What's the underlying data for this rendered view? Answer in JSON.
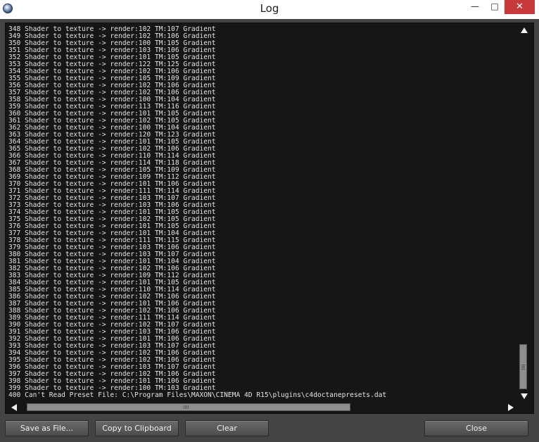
{
  "window": {
    "title": "Log",
    "minimize_glyph": "—",
    "maximize_glyph": "□",
    "close_glyph": "✕"
  },
  "log": {
    "lines": [
      {
        "num": "348",
        "text": "Shader to texture -> render:102 TM:107 Gradient"
      },
      {
        "num": "349",
        "text": "Shader to texture -> render:102 TM:106 Gradient"
      },
      {
        "num": "350",
        "text": "Shader to texture -> render:100 TM:105 Gradient"
      },
      {
        "num": "351",
        "text": "Shader to texture -> render:103 TM:106 Gradient"
      },
      {
        "num": "352",
        "text": "Shader to texture -> render:101 TM:105 Gradient"
      },
      {
        "num": "353",
        "text": "Shader to texture -> render:122 TM:125 Gradient"
      },
      {
        "num": "354",
        "text": "Shader to texture -> render:102 TM:106 Gradient"
      },
      {
        "num": "355",
        "text": "Shader to texture -> render:105 TM:109 Gradient"
      },
      {
        "num": "356",
        "text": "Shader to texture -> render:102 TM:106 Gradient"
      },
      {
        "num": "357",
        "text": "Shader to texture -> render:102 TM:106 Gradient"
      },
      {
        "num": "358",
        "text": "Shader to texture -> render:100 TM:104 Gradient"
      },
      {
        "num": "359",
        "text": "Shader to texture -> render:113 TM:116 Gradient"
      },
      {
        "num": "360",
        "text": "Shader to texture -> render:101 TM:105 Gradient"
      },
      {
        "num": "361",
        "text": "Shader to texture -> render:102 TM:105 Gradient"
      },
      {
        "num": "362",
        "text": "Shader to texture -> render:100 TM:104 Gradient"
      },
      {
        "num": "363",
        "text": "Shader to texture -> render:120 TM:123 Gradient"
      },
      {
        "num": "364",
        "text": "Shader to texture -> render:101 TM:105 Gradient"
      },
      {
        "num": "365",
        "text": "Shader to texture -> render:102 TM:106 Gradient"
      },
      {
        "num": "366",
        "text": "Shader to texture -> render:110 TM:114 Gradient"
      },
      {
        "num": "367",
        "text": "Shader to texture -> render:114 TM:118 Gradient"
      },
      {
        "num": "368",
        "text": "Shader to texture -> render:105 TM:109 Gradient"
      },
      {
        "num": "369",
        "text": "Shader to texture -> render:109 TM:112 Gradient"
      },
      {
        "num": "370",
        "text": "Shader to texture -> render:101 TM:106 Gradient"
      },
      {
        "num": "371",
        "text": "Shader to texture -> render:111 TM:114 Gradient"
      },
      {
        "num": "372",
        "text": "Shader to texture -> render:103 TM:107 Gradient"
      },
      {
        "num": "373",
        "text": "Shader to texture -> render:103 TM:106 Gradient"
      },
      {
        "num": "374",
        "text": "Shader to texture -> render:101 TM:105 Gradient"
      },
      {
        "num": "375",
        "text": "Shader to texture -> render:102 TM:105 Gradient"
      },
      {
        "num": "376",
        "text": "Shader to texture -> render:101 TM:105 Gradient"
      },
      {
        "num": "377",
        "text": "Shader to texture -> render:101 TM:104 Gradient"
      },
      {
        "num": "378",
        "text": "Shader to texture -> render:111 TM:115 Gradient"
      },
      {
        "num": "379",
        "text": "Shader to texture -> render:103 TM:106 Gradient"
      },
      {
        "num": "380",
        "text": "Shader to texture -> render:103 TM:107 Gradient"
      },
      {
        "num": "381",
        "text": "Shader to texture -> render:101 TM:104 Gradient"
      },
      {
        "num": "382",
        "text": "Shader to texture -> render:102 TM:106 Gradient"
      },
      {
        "num": "383",
        "text": "Shader to texture -> render:109 TM:112 Gradient"
      },
      {
        "num": "384",
        "text": "Shader to texture -> render:101 TM:105 Gradient"
      },
      {
        "num": "385",
        "text": "Shader to texture -> render:110 TM:114 Gradient"
      },
      {
        "num": "386",
        "text": "Shader to texture -> render:102 TM:106 Gradient"
      },
      {
        "num": "387",
        "text": "Shader to texture -> render:101 TM:106 Gradient"
      },
      {
        "num": "388",
        "text": "Shader to texture -> render:102 TM:106 Gradient"
      },
      {
        "num": "389",
        "text": "Shader to texture -> render:111 TM:114 Gradient"
      },
      {
        "num": "390",
        "text": "Shader to texture -> render:102 TM:107 Gradient"
      },
      {
        "num": "391",
        "text": "Shader to texture -> render:103 TM:106 Gradient"
      },
      {
        "num": "392",
        "text": "Shader to texture -> render:101 TM:106 Gradient"
      },
      {
        "num": "393",
        "text": "Shader to texture -> render:103 TM:107 Gradient"
      },
      {
        "num": "394",
        "text": "Shader to texture -> render:102 TM:106 Gradient"
      },
      {
        "num": "395",
        "text": "Shader to texture -> render:102 TM:106 Gradient"
      },
      {
        "num": "396",
        "text": "Shader to texture -> render:103 TM:107 Gradient"
      },
      {
        "num": "397",
        "text": "Shader to texture -> render:102 TM:106 Gradient"
      },
      {
        "num": "398",
        "text": "Shader to texture -> render:101 TM:106 Gradient"
      },
      {
        "num": "399",
        "text": "Shader to texture -> render:100 TM:103 Gradient"
      },
      {
        "num": "400",
        "text": "Can't Read Preset File: C:\\Program Files\\MAXON\\CINEMA 4D R15\\plugins\\c4doctanepresets.dat"
      }
    ]
  },
  "buttons": {
    "save_as_file": "Save as File...",
    "copy_to_clipboard": "Copy to Clipboard",
    "clear": "Clear",
    "close": "Close"
  },
  "colors": {
    "log_background": "#161616",
    "log_text": "#e4e4e4",
    "window_background": "#444444",
    "close_button": "#c7393b"
  }
}
